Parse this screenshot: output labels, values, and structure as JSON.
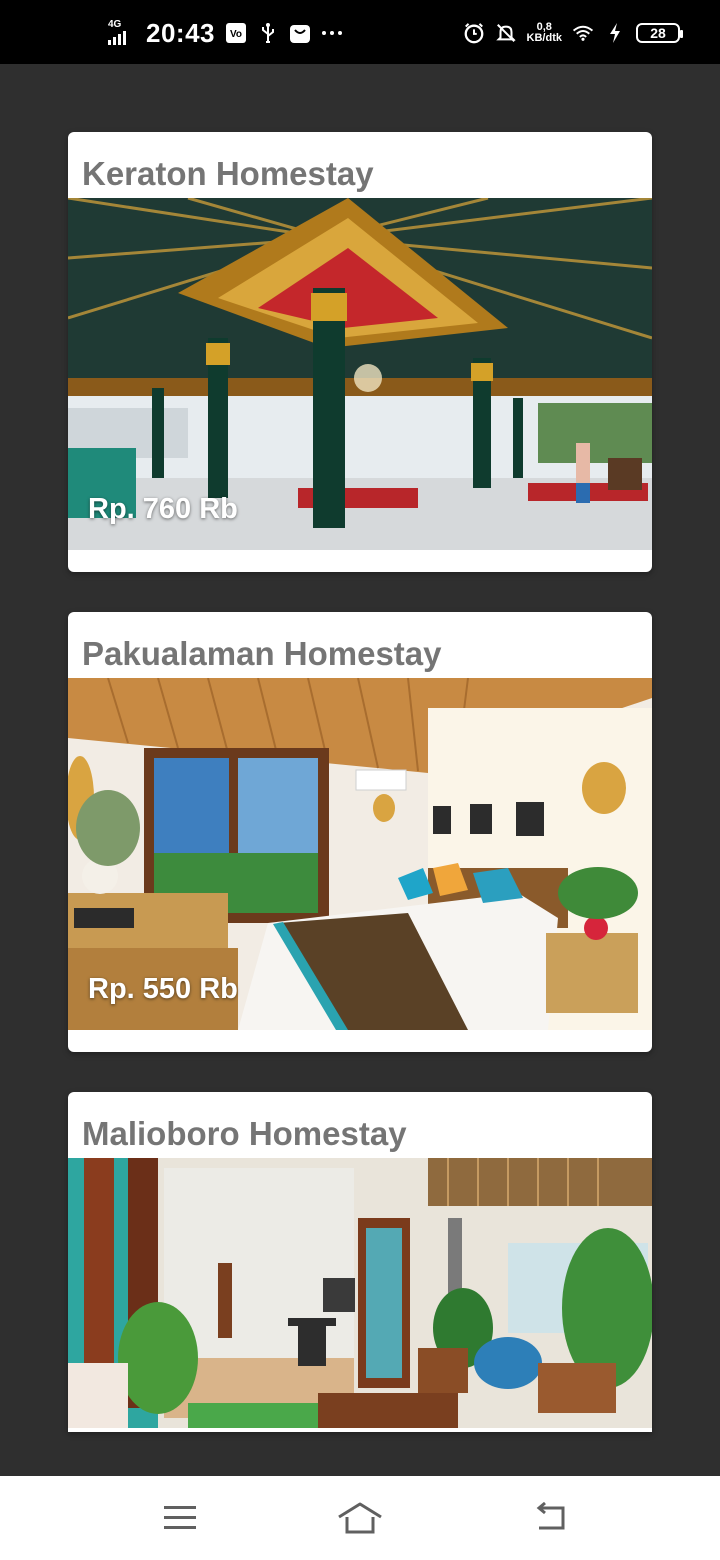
{
  "status_bar": {
    "network": "4G",
    "time": "20:43",
    "speed_value": "0,8",
    "speed_unit": "KB/dtk",
    "battery": "28",
    "icons": [
      "signal-icon",
      "vpn-icon",
      "usb-icon",
      "bag-icon",
      "more-dots-icon",
      "alarm-icon",
      "mute-bell-icon",
      "wifi-icon",
      "charging-icon",
      "battery-icon"
    ]
  },
  "listings": [
    {
      "name": "Keraton Homestay",
      "price": "Rp. 760 Rb",
      "photo": "pavilion-photo"
    },
    {
      "name": "Pakualaman Homestay",
      "price": "Rp. 550 Rb",
      "photo": "bedroom-photo"
    },
    {
      "name": "Malioboro Homestay",
      "price": "",
      "photo": "patio-photo"
    }
  ],
  "nav_bar": {
    "icons": [
      "menu-icon",
      "home-icon",
      "back-icon"
    ]
  },
  "colors": {
    "background": "#2f2f2f",
    "card": "#ffffff",
    "title_text": "#757575",
    "price_text": "#ffffff"
  }
}
